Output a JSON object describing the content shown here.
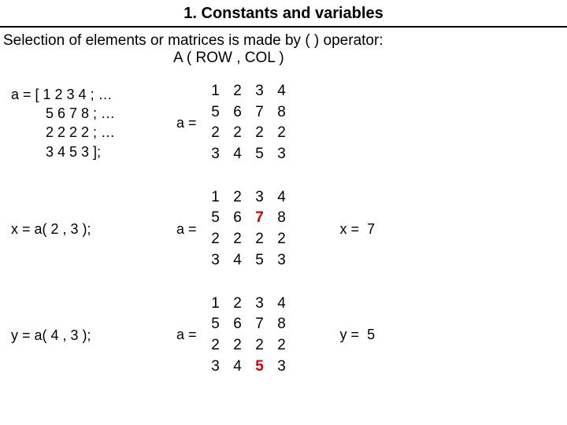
{
  "title": "1. Constants and variables",
  "intro_line1": "Selection of elements or matrices is made by ( ) operator:",
  "intro_line2": "A ( ROW , COL )",
  "matrix_label": "a =",
  "code": {
    "def": [
      "a = [ 1 2 3 4 ; …",
      "5 6 7 8 ; …",
      "2 2 2 2 ; …",
      "3 4 5 3 ];"
    ],
    "x": "x = a( 2 , 3 );",
    "y": "y = a( 4 , 3 );"
  },
  "matrix": [
    [
      "1",
      "2",
      "3",
      "4"
    ],
    [
      "5",
      "6",
      "7",
      "8"
    ],
    [
      "2",
      "2",
      "2",
      "2"
    ],
    [
      "3",
      "4",
      "5",
      "3"
    ]
  ],
  "x_hl": {
    "r": 1,
    "c": 2
  },
  "y_hl": {
    "r": 3,
    "c": 2
  },
  "result": {
    "x_label": "x =",
    "x_val": "7",
    "y_label": "y =",
    "y_val": "5"
  }
}
